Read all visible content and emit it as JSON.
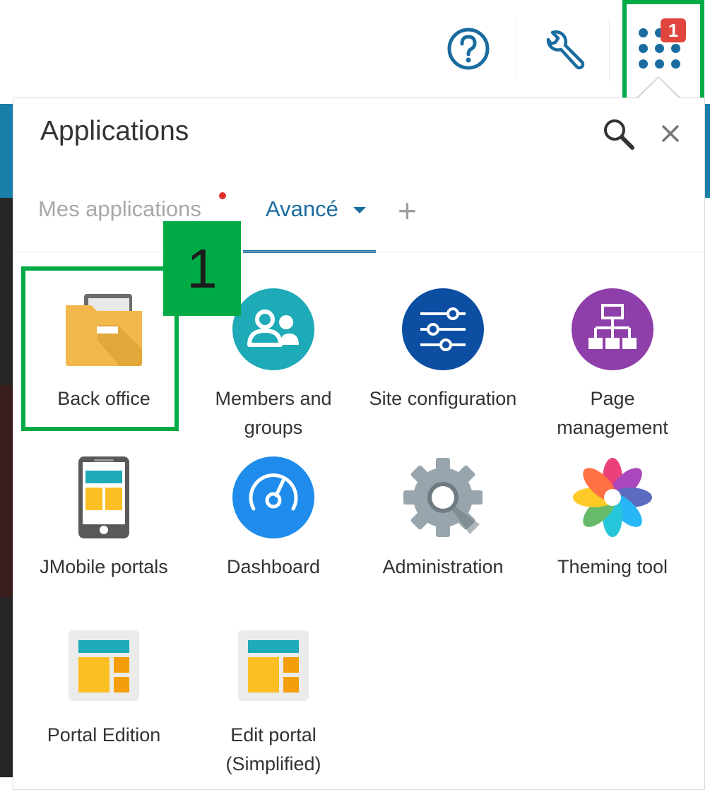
{
  "header": {
    "apps_badge": "1"
  },
  "panel": {
    "title": "Applications",
    "tabs": [
      {
        "label": "Mes applications"
      },
      {
        "label": "Avancé"
      }
    ],
    "add_symbol": "+"
  },
  "apps": [
    {
      "label": "Back office",
      "icon": "folder-icon"
    },
    {
      "label": "Members and groups",
      "icon": "users-icon"
    },
    {
      "label": "Site configuration",
      "icon": "sliders-icon"
    },
    {
      "label": "Page management",
      "icon": "sitemap-icon"
    },
    {
      "label": "JMobile portals",
      "icon": "phone-icon"
    },
    {
      "label": "Dashboard",
      "icon": "gauge-icon"
    },
    {
      "label": "Administration",
      "icon": "gear-icon"
    },
    {
      "label": "Theming tool",
      "icon": "flower-icon"
    },
    {
      "label": "Portal Edition",
      "icon": "layout-icon"
    },
    {
      "label": "Edit portal (Simplified)",
      "icon": "layout-icon"
    }
  ],
  "annotation": {
    "step_number": "1"
  },
  "colors": {
    "accent": "#1a6c9f",
    "highlight": "#00ab45",
    "badge": "#e0463e"
  }
}
